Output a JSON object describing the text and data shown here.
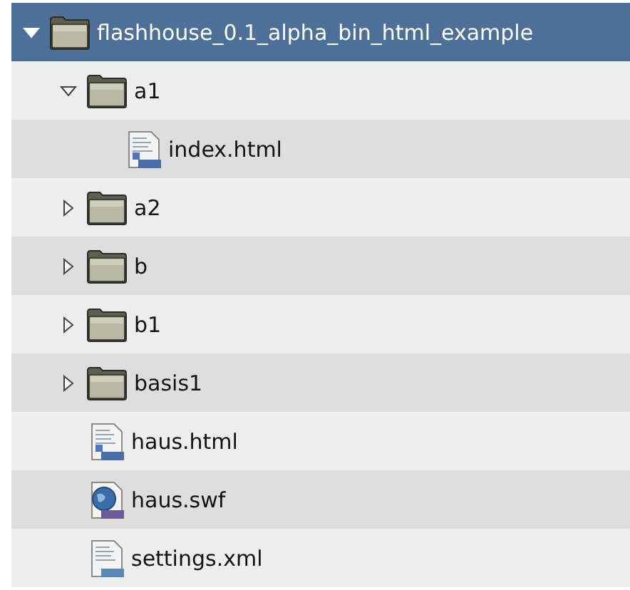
{
  "tree": [
    {
      "name": "flashhouse_0.1_alpha_bin_html_example",
      "kind": "folder",
      "expanded": true,
      "selected": true,
      "children": [
        {
          "name": "a1",
          "kind": "folder",
          "expanded": true,
          "selected": false,
          "children": [
            {
              "name": "index.html",
              "kind": "html",
              "selected": false
            }
          ]
        },
        {
          "name": "a2",
          "kind": "folder",
          "expanded": false,
          "selected": false
        },
        {
          "name": "b",
          "kind": "folder",
          "expanded": false,
          "selected": false
        },
        {
          "name": "b1",
          "kind": "folder",
          "expanded": false,
          "selected": false
        },
        {
          "name": "basis1",
          "kind": "folder",
          "expanded": false,
          "selected": false
        },
        {
          "name": "haus.html",
          "kind": "html",
          "selected": false
        },
        {
          "name": "haus.swf",
          "kind": "swf",
          "selected": false
        },
        {
          "name": "settings.xml",
          "kind": "xml",
          "selected": false
        }
      ]
    }
  ]
}
